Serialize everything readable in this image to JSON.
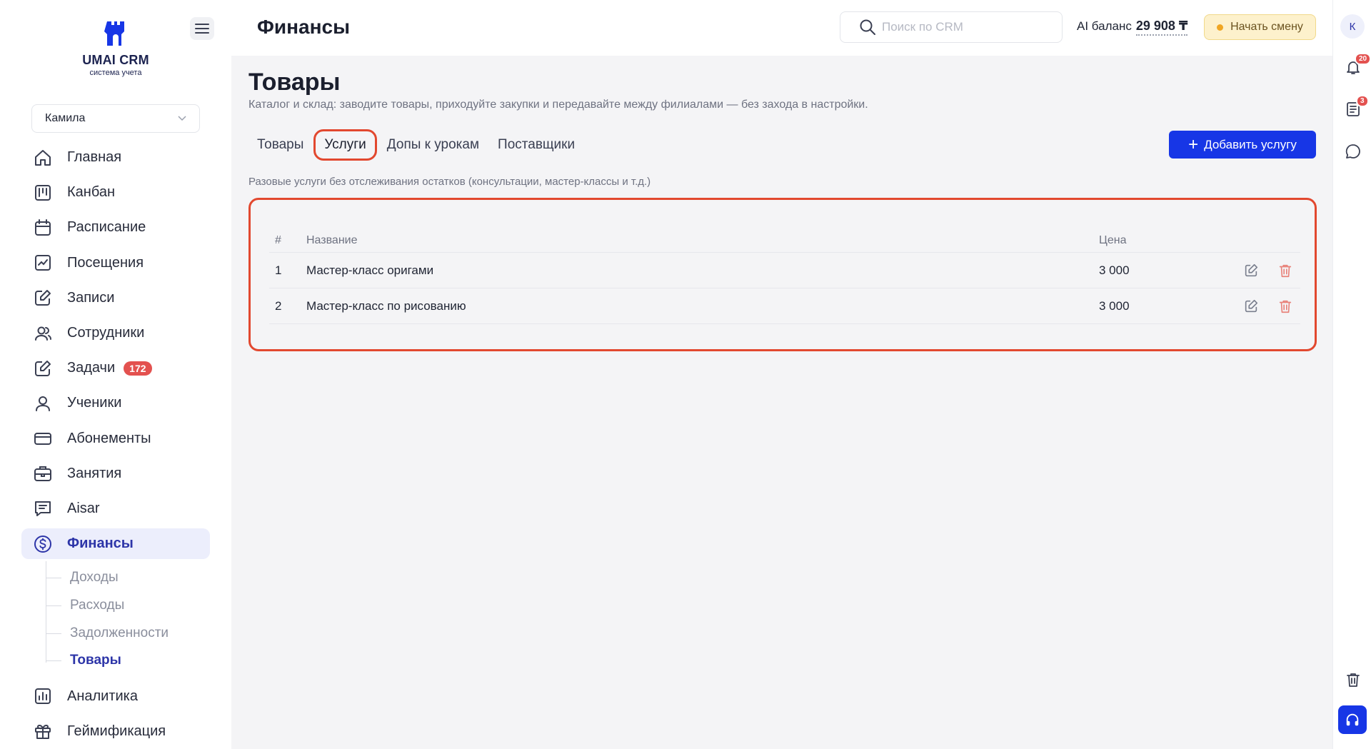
{
  "brand": {
    "name": "UMAI CRM",
    "tagline": "система учета"
  },
  "sidebar": {
    "branch": "Камила",
    "items": [
      {
        "label": "Главная",
        "icon": "home-icon"
      },
      {
        "label": "Канбан",
        "icon": "kanban-icon"
      },
      {
        "label": "Расписание",
        "icon": "calendar-icon"
      },
      {
        "label": "Посещения",
        "icon": "chart-check-icon"
      },
      {
        "label": "Записи",
        "icon": "edit-note-icon"
      },
      {
        "label": "Сотрудники",
        "icon": "users-icon"
      },
      {
        "label": "Задачи",
        "icon": "edit-note-icon",
        "badge": "172"
      },
      {
        "label": "Ученики",
        "icon": "user-icon"
      },
      {
        "label": "Абонементы",
        "icon": "card-icon"
      },
      {
        "label": "Занятия",
        "icon": "briefcase-icon"
      },
      {
        "label": "Aisar",
        "icon": "message-icon"
      },
      {
        "label": "Финансы",
        "icon": "dollar-circle-icon",
        "active": true
      }
    ],
    "finance_subitems": [
      {
        "label": "Доходы"
      },
      {
        "label": "Расходы"
      },
      {
        "label": "Задолженности"
      },
      {
        "label": "Товары",
        "active": true
      }
    ],
    "bottom_items": [
      {
        "label": "Аналитика",
        "icon": "bar-chart-icon"
      },
      {
        "label": "Геймификация",
        "icon": "gift-icon"
      }
    ]
  },
  "header": {
    "title": "Финансы",
    "search_placeholder": "Поиск по CRM",
    "ai_balance_label": "AI баланс",
    "ai_balance_value": "29 908 ₸",
    "shift_button": "Начать смену"
  },
  "rail": {
    "avatar_letter": "К",
    "notifications_badge": "20",
    "tasks_badge": "3"
  },
  "main": {
    "heading": "Товары",
    "subtitle": "Каталог и склад: заводите товары, приходуйте закупки и передавайте между филиалами — без захода в настройки.",
    "tabs": [
      {
        "label": "Товары"
      },
      {
        "label": "Услуги",
        "active": true
      },
      {
        "label": "Допы к урокам"
      },
      {
        "label": "Поставщики"
      }
    ],
    "add_button": "Добавить услугу",
    "note": "Разовые услуги без отслеживания остатков (консультации, мастер-классы и т.д.)",
    "table": {
      "columns": [
        "#",
        "Название",
        "Цена"
      ],
      "rows": [
        {
          "num": "1",
          "name": "Мастер-класс оригами",
          "price": "3 000"
        },
        {
          "num": "2",
          "name": "Мастер-класс по рисованию",
          "price": "3 000"
        }
      ]
    }
  },
  "colors": {
    "accent": "#1736e6",
    "active_nav": "#2d35a8",
    "highlight": "#e2482f",
    "badge": "#e3514f"
  }
}
